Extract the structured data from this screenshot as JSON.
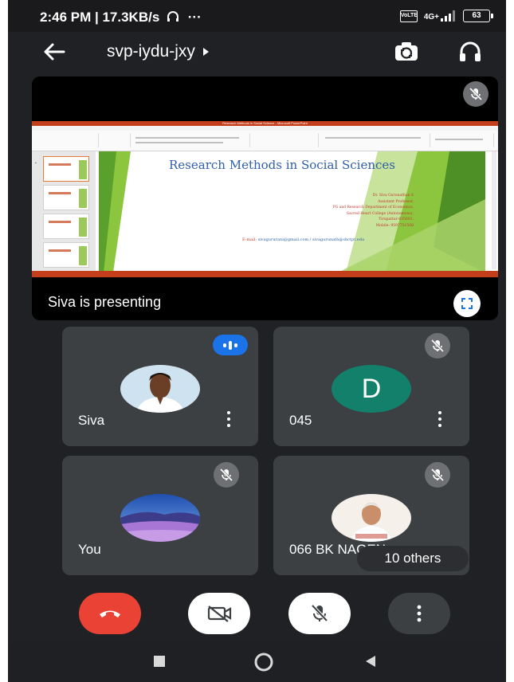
{
  "status_bar": {
    "time_speed": "2:46 PM | 17.3KB/s",
    "extra": "···",
    "sim_label": "VoLTE",
    "network": "4G+",
    "battery": "63"
  },
  "header": {
    "meeting_code": "svp-iydu-jxy"
  },
  "presentation": {
    "presenter_label": "Siva is presenting",
    "slide": {
      "window_title": "Research Methods in Social Science - Microsoft PowerPoint",
      "title": "Research Methods in Social Sciences",
      "author_lines": [
        "Dr. Siva Gurunathan S",
        "Assistant Professor,",
        "PG and Research Department of Economics,",
        "Sacred Heart College (Autonomous),",
        "Tirupattur-635601.",
        "Mobile: 9597751508"
      ],
      "email_label": "E-mail:",
      "email_values": "sivagururani@gmail.com / sivagurunath@shctpt.edu"
    }
  },
  "participants": [
    {
      "name": "Siva",
      "speaking": true
    },
    {
      "name": "045",
      "initial": "D",
      "avatar_color": "#12806b"
    },
    {
      "name": "You"
    },
    {
      "name": "066 BK NAGEN"
    }
  ],
  "others_label": "10 others",
  "colors": {
    "background": "#202124",
    "tile": "#3c4043",
    "end_call": "#ea4335",
    "speaking_badge": "#1a73e8",
    "powerpoint_accent": "#c43e1c"
  },
  "icons": {
    "back": "arrow-left-icon",
    "camera_switch": "camera-switch-icon",
    "audio": "headphones-icon",
    "mic_off": "mic-off-icon",
    "fullscreen": "fullscreen-icon",
    "end_call": "phone-hangup-icon",
    "camera_off": "video-off-icon",
    "more": "more-vertical-icon"
  }
}
